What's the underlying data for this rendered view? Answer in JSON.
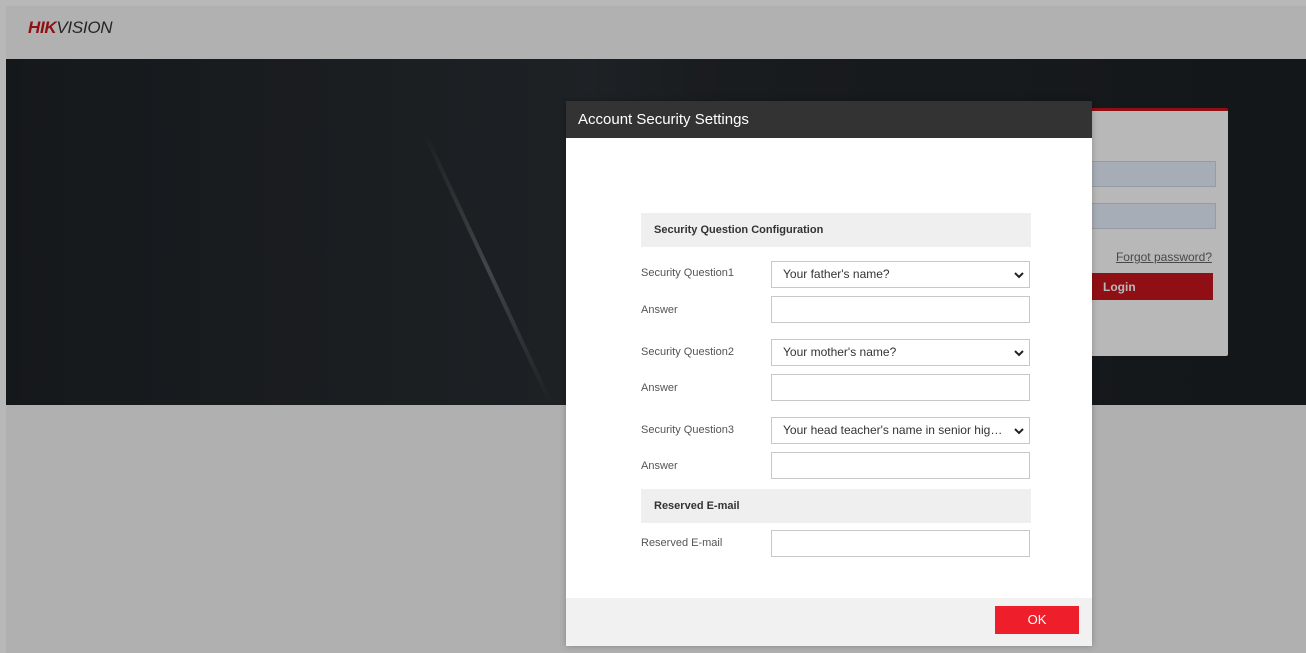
{
  "brand": {
    "logo_red": "HIK",
    "logo_dark": "VISION",
    "accent_color": "#c8161d"
  },
  "login": {
    "forgot_password": "Forgot password?",
    "login_button": "Login"
  },
  "modal": {
    "title": "Account Security Settings",
    "security_section": {
      "title": "Security Question Configuration",
      "questions": [
        {
          "label": "Security Question1",
          "selected": "Your father's name?",
          "answer_label": "Answer",
          "answer_value": ""
        },
        {
          "label": "Security Question2",
          "selected": "Your mother's name?",
          "answer_label": "Answer",
          "answer_value": ""
        },
        {
          "label": "Security Question3",
          "selected": "Your head teacher's name in senior high s...",
          "answer_label": "Answer",
          "answer_value": ""
        }
      ]
    },
    "email_section": {
      "title": "Reserved E-mail",
      "field_label": "Reserved E-mail",
      "field_value": ""
    },
    "ok_button": "OK",
    "ok_color": "#ee1f2b"
  }
}
